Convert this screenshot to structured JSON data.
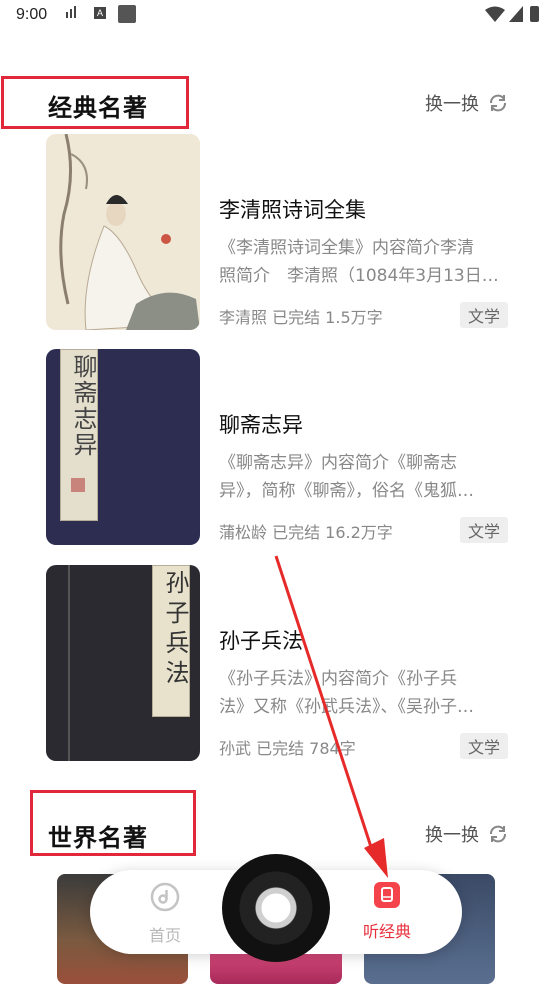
{
  "status_bar": {
    "time": "9:00",
    "a_badge": "A"
  },
  "sections": [
    {
      "title": "经典名著",
      "refresh_label": "换一换"
    },
    {
      "title": "世界名著",
      "refresh_label": "换一换"
    }
  ],
  "books": [
    {
      "title": "李清照诗词全集",
      "desc_line1": "《李清照诗词全集》内容简介李清",
      "desc_line2": "照简介　李清照（1084年3月13日…",
      "meta": "李清照 已完结 1.5万字",
      "tag": "文学",
      "cover_vertical_text": ""
    },
    {
      "title": "聊斋志异",
      "desc_line1": "《聊斋志异》内容简介《聊斋志",
      "desc_line2": "异》，简称《聊斋》，俗名《鬼狐…",
      "meta": "蒲松龄 已完结 16.2万字",
      "tag": "文学",
      "cover_vertical_text": "聊斋志异"
    },
    {
      "title": "孙子兵法",
      "desc_line1": "《孙子兵法》内容简介《孙子兵",
      "desc_line2": "法》又称《孙武兵法》、《吴孙子…",
      "meta": "孙武 已完结 78​4字",
      "tag": "文学",
      "cover_vertical_text": "孙子兵法"
    }
  ],
  "nav": {
    "home_label": "首页",
    "classic_label": "听经典"
  },
  "colors": {
    "accent": "#e8303d",
    "highlight": "#e0283a"
  }
}
